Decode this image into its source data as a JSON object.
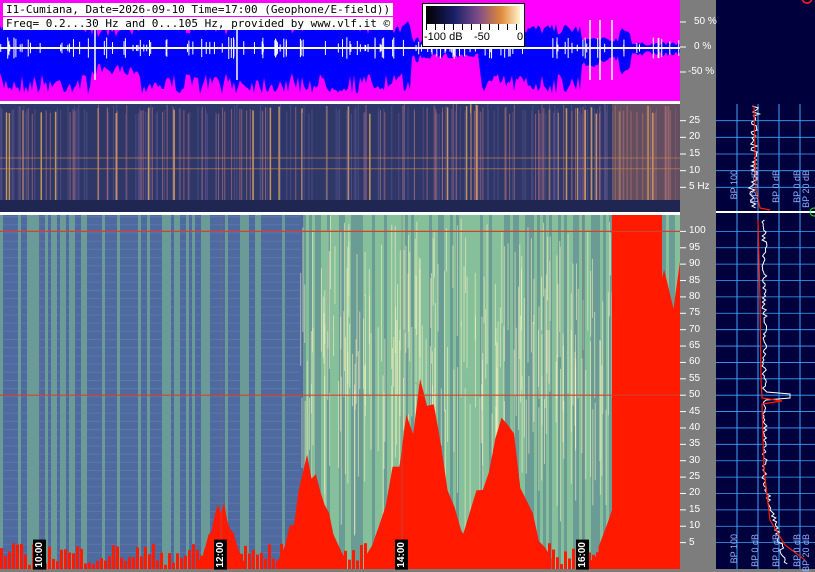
{
  "title": {
    "line1": "I1-Cumiana, Date=2026-09-10 Time=17:00 (Geophone/E-field))",
    "line2": "Freq= 0.2...30 Hz and 0...105 Hz, provided by www.vlf.it ©"
  },
  "colorbar": {
    "labels": [
      "-100 dB",
      "-50",
      "0"
    ]
  },
  "colors": {
    "waveform_bg": "#ff00ff",
    "waveform_fill": "#0000ff",
    "low_spec_bg": "#2e3768",
    "high_spec_bg": "#5f9a8a",
    "alarm_red": "#ff1a00",
    "right_panel": "#00003d",
    "grid_blue": "#3ea6ff"
  },
  "chart_data": [
    {
      "type": "line",
      "panel": "waveform",
      "ylabel": "",
      "y_ticks": [
        "50 %",
        "0 %",
        "-50 %"
      ],
      "x_ticks": []
    },
    {
      "type": "heatmap",
      "panel": "spectrogram 0.2-30 Hz",
      "y_ticks": [
        "25",
        "20",
        "15",
        "10",
        "5 Hz"
      ],
      "ylim": [
        0.2,
        30
      ],
      "persistent_lines_hz": [
        15,
        12
      ]
    },
    {
      "type": "heatmap",
      "panel": "spectrogram 0-105 Hz",
      "y_ticks": [
        "100",
        "95",
        "90",
        "85",
        "80",
        "75",
        "70",
        "65",
        "60",
        "55",
        "50",
        "45",
        "40",
        "35",
        "30",
        "25",
        "20",
        "15",
        "10",
        "5"
      ],
      "ylim": [
        0,
        105
      ],
      "x_ticks": [
        "10:00",
        "12:00",
        "14:00",
        "16:00"
      ],
      "persistent_lines_hz": [
        50,
        100
      ],
      "red_burst_hours": [
        12.0,
        13.0,
        14.2,
        15.1,
        16.5,
        17.0
      ]
    },
    {
      "type": "line",
      "panel": "averaged spectrum",
      "legend_labels": [
        "BP 100",
        "BP 0 dB",
        "BP 0 dB",
        "BP 0 dB",
        "BP 20 dB"
      ],
      "peak_hz": 50
    }
  ]
}
